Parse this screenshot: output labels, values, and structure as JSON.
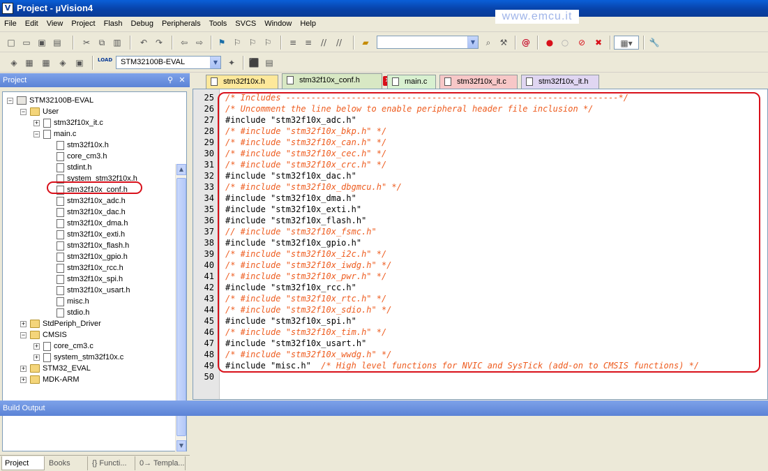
{
  "window": {
    "title": "Project  -  µVision4",
    "watermark": "www.emcu.it"
  },
  "menu": [
    "File",
    "Edit",
    "View",
    "Project",
    "Flash",
    "Debug",
    "Peripherals",
    "Tools",
    "SVCS",
    "Window",
    "Help"
  ],
  "toolbar2": {
    "target_combo": "STM32100B-EVAL",
    "load_label": "LOAD"
  },
  "project_panel": {
    "title": "Project",
    "tree": [
      {
        "label": "STM32100B-EVAL",
        "level": 0,
        "expander": "−",
        "icon": "target"
      },
      {
        "label": "User",
        "level": 1,
        "expander": "−",
        "icon": "folder"
      },
      {
        "label": "stm32f10x_it.c",
        "level": 2,
        "expander": "+",
        "icon": "filec"
      },
      {
        "label": "main.c",
        "level": 2,
        "expander": "−",
        "icon": "filec"
      },
      {
        "label": "stm32f10x.h",
        "level": 3,
        "expander": "",
        "icon": "file"
      },
      {
        "label": "core_cm3.h",
        "level": 3,
        "expander": "",
        "icon": "file"
      },
      {
        "label": "stdint.h",
        "level": 3,
        "expander": "",
        "icon": "file"
      },
      {
        "label": "system_stm32f10x.h",
        "level": 3,
        "expander": "",
        "icon": "file"
      },
      {
        "label": "stm32f10x_conf.h",
        "level": 3,
        "expander": "",
        "icon": "file"
      },
      {
        "label": "stm32f10x_adc.h",
        "level": 3,
        "expander": "",
        "icon": "file"
      },
      {
        "label": "stm32f10x_dac.h",
        "level": 3,
        "expander": "",
        "icon": "file"
      },
      {
        "label": "stm32f10x_dma.h",
        "level": 3,
        "expander": "",
        "icon": "file"
      },
      {
        "label": "stm32f10x_exti.h",
        "level": 3,
        "expander": "",
        "icon": "file"
      },
      {
        "label": "stm32f10x_flash.h",
        "level": 3,
        "expander": "",
        "icon": "file"
      },
      {
        "label": "stm32f10x_gpio.h",
        "level": 3,
        "expander": "",
        "icon": "file"
      },
      {
        "label": "stm32f10x_rcc.h",
        "level": 3,
        "expander": "",
        "icon": "file"
      },
      {
        "label": "stm32f10x_spi.h",
        "level": 3,
        "expander": "",
        "icon": "file"
      },
      {
        "label": "stm32f10x_usart.h",
        "level": 3,
        "expander": "",
        "icon": "file"
      },
      {
        "label": "misc.h",
        "level": 3,
        "expander": "",
        "icon": "file"
      },
      {
        "label": "stdio.h",
        "level": 3,
        "expander": "",
        "icon": "file"
      },
      {
        "label": "StdPeriph_Driver",
        "level": 1,
        "expander": "+",
        "icon": "folder"
      },
      {
        "label": "CMSIS",
        "level": 1,
        "expander": "−",
        "icon": "folder"
      },
      {
        "label": "core_cm3.c",
        "level": 2,
        "expander": "+",
        "icon": "filec"
      },
      {
        "label": "system_stm32f10x.c",
        "level": 2,
        "expander": "+",
        "icon": "filec"
      },
      {
        "label": "STM32_EVAL",
        "level": 1,
        "expander": "+",
        "icon": "folder"
      },
      {
        "label": "MDK-ARM",
        "level": 1,
        "expander": "+",
        "icon": "folder"
      }
    ],
    "tabs": [
      {
        "label": "Project",
        "active": true
      },
      {
        "label": "Books",
        "active": false
      },
      {
        "label": "{} Functi...",
        "active": false
      },
      {
        "label": "0→ Templa...",
        "active": false
      }
    ]
  },
  "editor": {
    "tabs": [
      {
        "label": "stm32f10x.h",
        "color": "#fde89a"
      },
      {
        "label": "stm32f10x_conf.h",
        "color": "#d8e8c4",
        "active": true
      },
      {
        "label": "main.c",
        "color": "#d8f0d0"
      },
      {
        "label": "stm32f10x_it.c",
        "color": "#f7c7c7"
      },
      {
        "label": "stm32f10x_it.h",
        "color": "#e0d6f2"
      }
    ],
    "lines": [
      {
        "n": "25",
        "text": "/* Includes ------------------------------------------------------------------*/",
        "type": "cmt"
      },
      {
        "n": "26",
        "text": "/* Uncomment the line below to enable peripheral header file inclusion */",
        "type": "cmt"
      },
      {
        "n": "27",
        "text": "#include \"stm32f10x_adc.h\"",
        "type": "code"
      },
      {
        "n": "28",
        "text": "/* #include \"stm32f10x_bkp.h\" */",
        "type": "cmt"
      },
      {
        "n": "29",
        "text": "/* #include \"stm32f10x_can.h\" */",
        "type": "cmt"
      },
      {
        "n": "30",
        "text": "/* #include \"stm32f10x_cec.h\" */",
        "type": "cmt"
      },
      {
        "n": "31",
        "text": "/* #include \"stm32f10x_crc.h\" */",
        "type": "cmt"
      },
      {
        "n": "32",
        "text": "#include \"stm32f10x_dac.h\"",
        "type": "code"
      },
      {
        "n": "33",
        "text": "/* #include \"stm32f10x_dbgmcu.h\" */",
        "type": "cmt"
      },
      {
        "n": "34",
        "text": "#include \"stm32f10x_dma.h\"",
        "type": "code"
      },
      {
        "n": "35",
        "text": "#include \"stm32f10x_exti.h\"",
        "type": "code"
      },
      {
        "n": "36",
        "text": "#include \"stm32f10x_flash.h\"",
        "type": "code"
      },
      {
        "n": "37",
        "text": "// #include \"stm32f10x_fsmc.h\"",
        "type": "cmt"
      },
      {
        "n": "38",
        "text": "#include \"stm32f10x_gpio.h\"",
        "type": "code"
      },
      {
        "n": "39",
        "text": "/* #include \"stm32f10x_i2c.h\" */",
        "type": "cmt"
      },
      {
        "n": "40",
        "text": "/* #include \"stm32f10x_iwdg.h\" */",
        "type": "cmt"
      },
      {
        "n": "41",
        "text": "/* #include \"stm32f10x_pwr.h\" */",
        "type": "cmt"
      },
      {
        "n": "42",
        "text": "#include \"stm32f10x_rcc.h\"",
        "type": "code"
      },
      {
        "n": "43",
        "text": "/* #include \"stm32f10x_rtc.h\" */",
        "type": "cmt"
      },
      {
        "n": "44",
        "text": "/* #include \"stm32f10x_sdio.h\" */",
        "type": "cmt"
      },
      {
        "n": "45",
        "text": "#include \"stm32f10x_spi.h\"",
        "type": "code"
      },
      {
        "n": "46",
        "text": "/* #include \"stm32f10x_tim.h\" */",
        "type": "cmt"
      },
      {
        "n": "47",
        "text": "#include \"stm32f10x_usart.h\"",
        "type": "code"
      },
      {
        "n": "48",
        "text": "/* #include \"stm32f10x_wwdg.h\" */",
        "type": "cmt"
      },
      {
        "n": "49",
        "text": "#include \"misc.h\"  ",
        "type": "code",
        "trail": "/* High level functions for NVIC and SysTick (add-on to CMSIS functions) */"
      },
      {
        "n": "50",
        "text": "",
        "type": "code"
      }
    ]
  },
  "build_output": {
    "title": "Build Output"
  }
}
